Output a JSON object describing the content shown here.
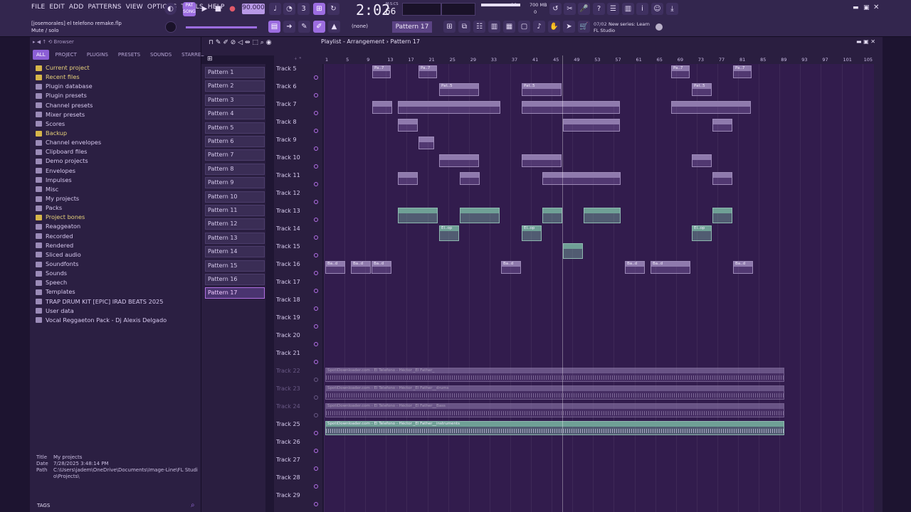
{
  "menu": [
    "FILE",
    "EDIT",
    "ADD",
    "PATTERNS",
    "VIEW",
    "OPTIONS",
    "TOOLS",
    "HELP"
  ],
  "transport": {
    "tempo": "90.000",
    "time": "2:02",
    "time_sub": "66",
    "time_unit": "M:S:CS",
    "memory": "700 MB",
    "cpu": "10",
    "polyphony": "0"
  },
  "project": {
    "file": "[josemorales] el telefono remake.flp",
    "hint": "Mute / solo"
  },
  "pattern_selector": {
    "pattern": "Pattern 17",
    "snap": "(none)"
  },
  "news": {
    "counter": "07/02",
    "title": "New series: Learn",
    "subtitle": "FL Studio"
  },
  "browser": {
    "title": "Browser",
    "tabs": [
      "ALL",
      "PROJECT",
      "PLUGINS",
      "PRESETS",
      "SOUNDS",
      "STARRED"
    ],
    "items": [
      {
        "label": "Current project",
        "icon": "folder-icon",
        "color": "yellow"
      },
      {
        "label": "Recent files",
        "icon": "folder-icon",
        "color": "yellow"
      },
      {
        "label": "Plugin database",
        "icon": "folder-icon",
        "color": "normal"
      },
      {
        "label": "Plugin presets",
        "icon": "folder-icon",
        "color": "normal"
      },
      {
        "label": "Channel presets",
        "icon": "folder-icon",
        "color": "normal"
      },
      {
        "label": "Mixer presets",
        "icon": "folder-icon",
        "color": "normal"
      },
      {
        "label": "Scores",
        "icon": "folder-icon",
        "color": "normal"
      },
      {
        "label": "Backup",
        "icon": "folder-icon",
        "color": "yellow"
      },
      {
        "label": "Channel envelopes",
        "icon": "folder-icon",
        "color": "normal"
      },
      {
        "label": "Clipboard files",
        "icon": "folder-icon",
        "color": "normal"
      },
      {
        "label": "Demo projects",
        "icon": "folder-icon",
        "color": "normal"
      },
      {
        "label": "Envelopes",
        "icon": "folder-icon",
        "color": "normal"
      },
      {
        "label": "Impulses",
        "icon": "folder-icon",
        "color": "normal"
      },
      {
        "label": "Misc",
        "icon": "folder-icon",
        "color": "normal"
      },
      {
        "label": "My projects",
        "icon": "folder-icon",
        "color": "normal"
      },
      {
        "label": "Packs",
        "icon": "folder-icon",
        "color": "normal"
      },
      {
        "label": "Project bones",
        "icon": "folder-icon",
        "color": "yellow"
      },
      {
        "label": "Reaggeaton",
        "icon": "folder-icon",
        "color": "normal"
      },
      {
        "label": "Recorded",
        "icon": "folder-icon",
        "color": "normal"
      },
      {
        "label": "Rendered",
        "icon": "folder-icon",
        "color": "normal"
      },
      {
        "label": "Sliced audio",
        "icon": "folder-icon",
        "color": "normal"
      },
      {
        "label": "Soundfonts",
        "icon": "folder-icon",
        "color": "normal"
      },
      {
        "label": "Sounds",
        "icon": "folder-icon",
        "color": "normal"
      },
      {
        "label": "Speech",
        "icon": "folder-icon",
        "color": "normal"
      },
      {
        "label": "Templates",
        "icon": "folder-icon",
        "color": "normal"
      },
      {
        "label": "TRAP DRUM KIT [EPIC] IRAD BEATS 2025",
        "icon": "folder-icon",
        "color": "normal"
      },
      {
        "label": "User data",
        "icon": "folder-icon",
        "color": "normal"
      },
      {
        "label": "Vocal Reggaeton Pack - Dj Alexis Delgado",
        "icon": "folder-icon",
        "color": "normal"
      }
    ],
    "info": {
      "title_label": "Title",
      "title_value": "My projects",
      "date_label": "Date",
      "date_value": "7/28/2025 3:48:14 PM",
      "path_label": "Path",
      "path_value": "C:\\Users\\jadem\\OneDrive\\Documents\\Image-Line\\FL Studio\\Projects\\"
    },
    "tags_label": "TAGS"
  },
  "playlist": {
    "title": "Playlist - Arrangement",
    "pattern": "Pattern 17",
    "patterns": [
      "Pattern 1",
      "Pattern 2",
      "Pattern 3",
      "Pattern 4",
      "Pattern 5",
      "Pattern 6",
      "Pattern 7",
      "Pattern 8",
      "Pattern 9",
      "Pattern 10",
      "Pattern 11",
      "Pattern 12",
      "Pattern 13",
      "Pattern 14",
      "Pattern 15",
      "Pattern 16",
      "Pattern 17"
    ],
    "selected_pattern": 16,
    "ruler": [
      "1",
      "5",
      "9",
      "13",
      "17",
      "21",
      "25",
      "29",
      "33",
      "37",
      "41",
      "45",
      "49",
      "53",
      "57",
      "61",
      "65",
      "69",
      "73",
      "77",
      "81",
      "85",
      "89",
      "93",
      "97",
      "101",
      "105"
    ],
    "tracks": [
      "Track 5",
      "Track 6",
      "Track 7",
      "Track 8",
      "Track 9",
      "Track 10",
      "Track 11",
      "Track 12",
      "Track 13",
      "Track 14",
      "Track 15",
      "Track 16",
      "Track 17",
      "Track 18",
      "Track 19",
      "Track 20",
      "Track 21",
      "Track 22",
      "Track 23",
      "Track 24",
      "Track 25",
      "Track 26",
      "Track 27",
      "Track 28",
      "Track 29"
    ],
    "muted_tracks": [
      17,
      18,
      19
    ],
    "audio_clips": [
      {
        "track": 17,
        "label": "SpotiDownloader.com - El Telefono - Héctor _El Father_"
      },
      {
        "track": 18,
        "label": "SpotiDownloader.com - El Telefono - Héctor _El Father__drums"
      },
      {
        "track": 19,
        "label": "SpotiDownloader.com - El Telefono - Héctor _El Father__Bass"
      },
      {
        "track": 20,
        "label": "SpotiDownloader.com - El Telefono - Héctor _El Father__instruments"
      }
    ],
    "clip_labels": {
      "pa7": "Pa..7",
      "pat5": "Pat..5",
      "elop": "El..op",
      "bad": "Ba..d"
    }
  }
}
